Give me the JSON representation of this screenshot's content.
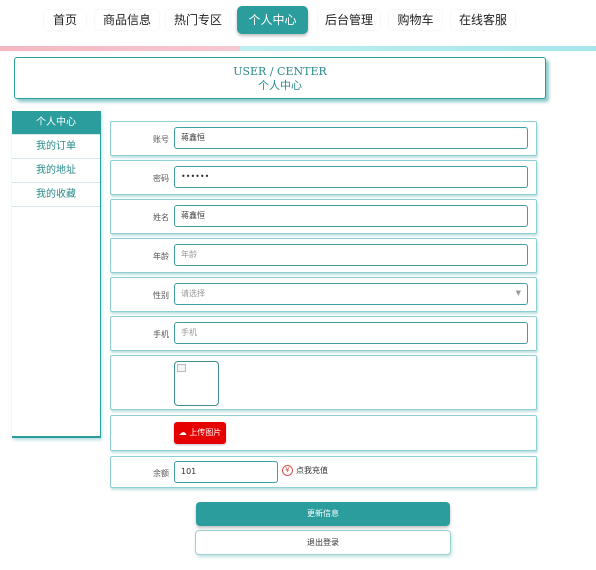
{
  "nav": {
    "items": [
      {
        "label": "首页"
      },
      {
        "label": "商品信息"
      },
      {
        "label": "热门专区"
      },
      {
        "label": "个人中心"
      },
      {
        "label": "后台管理"
      },
      {
        "label": "购物车"
      },
      {
        "label": "在线客服"
      }
    ],
    "active_index": 3
  },
  "header": {
    "title_en": "USER / CENTER",
    "title_cn": "个人中心"
  },
  "sidebar": {
    "items": [
      {
        "label": "个人中心"
      },
      {
        "label": "我的订单"
      },
      {
        "label": "我的地址"
      },
      {
        "label": "我的收藏"
      }
    ],
    "active_index": 0
  },
  "form": {
    "account": {
      "label": "账号",
      "value": "蒋鑫恒"
    },
    "password": {
      "label": "密码",
      "value": "••••••"
    },
    "name": {
      "label": "姓名",
      "value": "蒋鑫恒"
    },
    "age": {
      "label": "年龄",
      "placeholder": "年龄"
    },
    "gender": {
      "label": "性别",
      "placeholder": "请选择"
    },
    "phone": {
      "label": "手机",
      "placeholder": "手机"
    },
    "upload": {
      "label": "上传图片"
    },
    "balance": {
      "label": "余额",
      "value": "101",
      "recharge_label": "点我充值"
    }
  },
  "actions": {
    "update_label": "更新信息",
    "logout_label": "退出登录"
  },
  "colors": {
    "accent": "#2a9d9c",
    "upload_button": "#e60000"
  }
}
